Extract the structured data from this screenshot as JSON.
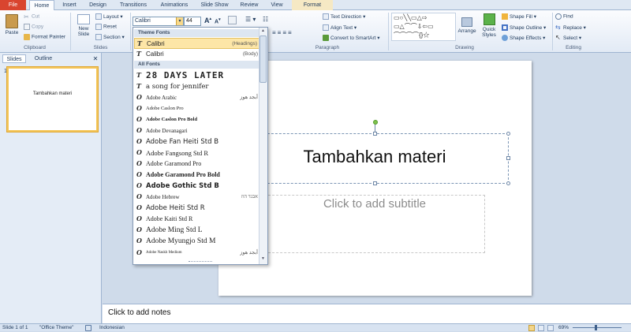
{
  "tabs": [
    "File",
    "Home",
    "Insert",
    "Design",
    "Transitions",
    "Animations",
    "Slide Show",
    "Review",
    "View",
    "Format"
  ],
  "clipboard": {
    "paste": "Paste",
    "cut": "Cut",
    "copy": "Copy",
    "format_painter": "Format Painter",
    "label": "Clipboard"
  },
  "slides_group": {
    "new_slide": "New Slide",
    "layout": "Layout",
    "reset": "Reset",
    "section": "Section",
    "label": "Slides"
  },
  "font": {
    "value": "Calibri",
    "size": "44"
  },
  "paragraph": {
    "text_direction": "Text Direction",
    "align_text": "Align Text",
    "convert": "Convert to SmartArt",
    "label": "Paragraph"
  },
  "drawing": {
    "arrange": "Arrange",
    "quick_styles": "Quick Styles",
    "shape_fill": "Shape Fill",
    "shape_outline": "Shape Outline",
    "shape_effects": "Shape Effects",
    "label": "Drawing"
  },
  "editing": {
    "find": "Find",
    "replace": "Replace",
    "select": "Select",
    "label": "Editing"
  },
  "panel": {
    "slides_tab": "Slides",
    "outline_tab": "Outline",
    "slide_num": "1",
    "thumb_text": "Tambahkan materi"
  },
  "slide": {
    "title": "Tambahkan materi",
    "subtitle": "Click to add subtitle"
  },
  "notes": "Click to add notes",
  "status": {
    "slide": "Slide 1 of 1",
    "theme": "\"Office Theme\"",
    "lang": "Indonesian",
    "zoom": "69%"
  },
  "fontlist": {
    "theme_header": "Theme Fonts",
    "theme_fonts": [
      {
        "name": "Calibri",
        "tag": "(Headings)"
      },
      {
        "name": "Calibri",
        "tag": "(Body)"
      }
    ],
    "all_header": "All Fonts",
    "all_fonts": [
      {
        "name": "28 DAYS LATER",
        "tag": ""
      },
      {
        "name": "a song for jennifer",
        "tag": ""
      },
      {
        "name": "Adobe Arabic",
        "tag": "أبجد هوز"
      },
      {
        "name": "Adobe Caslon Pro",
        "tag": ""
      },
      {
        "name": "Adobe Caslon Pro Bold",
        "tag": ""
      },
      {
        "name": "Adobe Devanagari",
        "tag": ""
      },
      {
        "name": "Adobe Fan Heiti Std B",
        "tag": ""
      },
      {
        "name": "Adobe Fangsong Std R",
        "tag": ""
      },
      {
        "name": "Adobe Garamond Pro",
        "tag": ""
      },
      {
        "name": "Adobe Garamond Pro Bold",
        "tag": ""
      },
      {
        "name": "Adobe Gothic Std B",
        "tag": ""
      },
      {
        "name": "Adobe Hebrew",
        "tag": "אבגד הוז"
      },
      {
        "name": "Adobe Heiti Std R",
        "tag": ""
      },
      {
        "name": "Adobe Kaiti Std R",
        "tag": ""
      },
      {
        "name": "Adobe Ming Std L",
        "tag": ""
      },
      {
        "name": "Adobe Myungjo Std M",
        "tag": ""
      },
      {
        "name": "Adobe Naskh Medium",
        "tag": "أبجد هوز"
      }
    ]
  }
}
